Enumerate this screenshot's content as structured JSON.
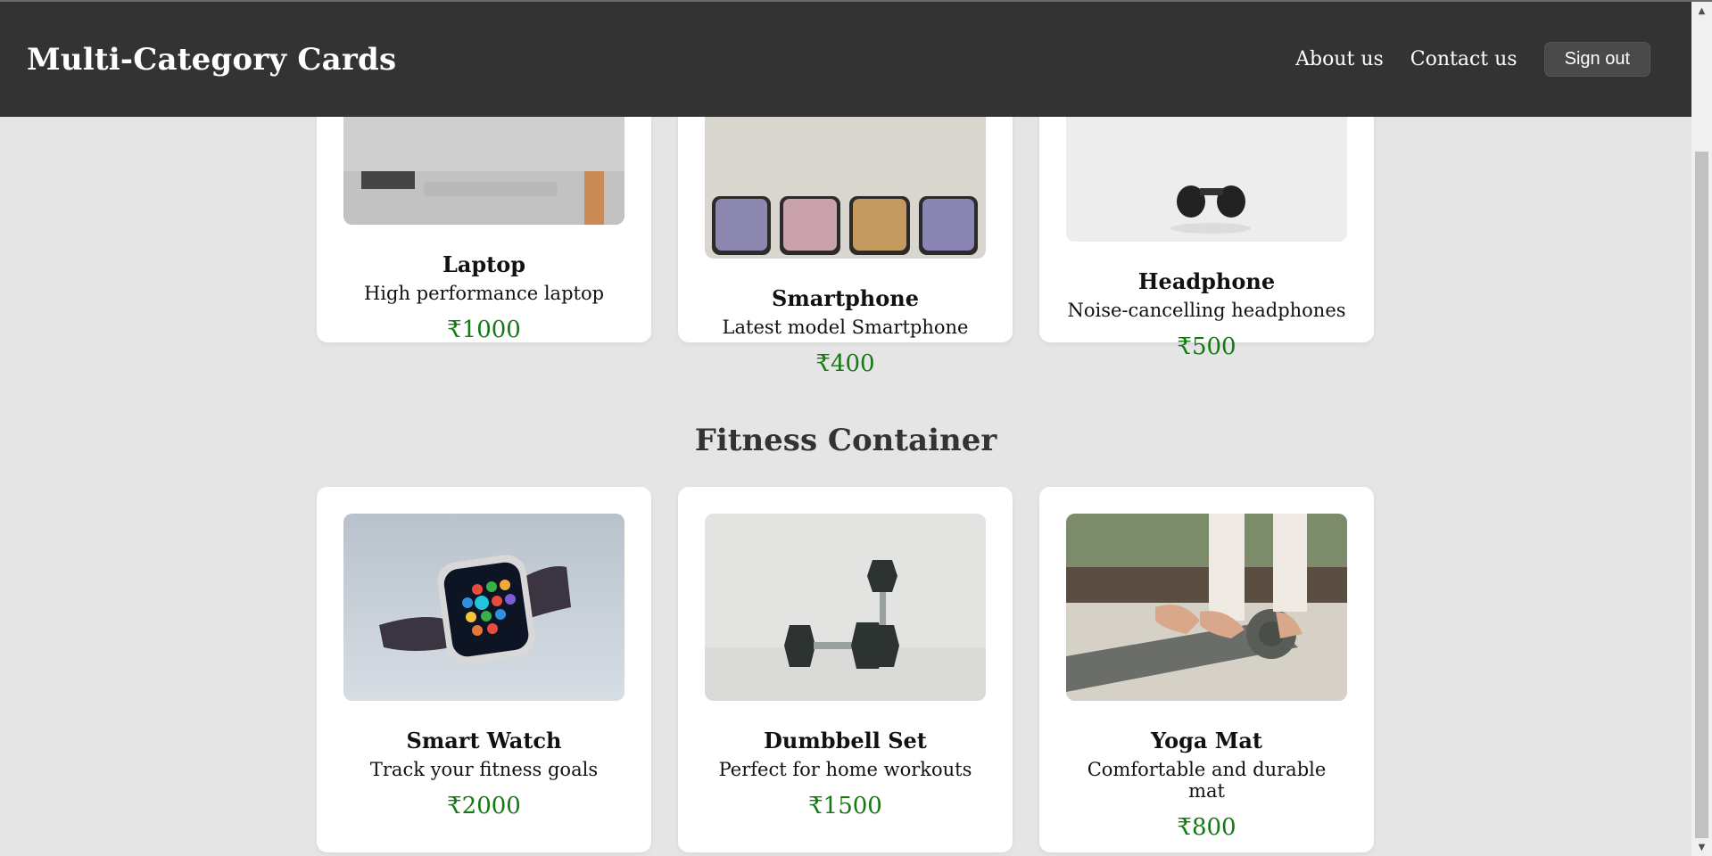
{
  "header": {
    "brand": "Multi-Category Cards",
    "nav": [
      {
        "label": "About us"
      },
      {
        "label": "Contact us"
      }
    ],
    "signout_label": "Sign out"
  },
  "electronics": {
    "cards": [
      {
        "title": "Laptop",
        "desc": "High performance laptop",
        "price": "₹1000"
      },
      {
        "title": "Smartphone",
        "desc": "Latest model Smartphone",
        "price": "₹400"
      },
      {
        "title": "Headphone",
        "desc": "Noise-cancelling headphones",
        "price": "₹500"
      }
    ]
  },
  "fitness": {
    "title": "Fitness Container",
    "cards": [
      {
        "title": "Smart Watch",
        "desc": "Track your fitness goals",
        "price": "₹2000"
      },
      {
        "title": "Dumbbell Set",
        "desc": "Perfect for home workouts",
        "price": "₹1500"
      },
      {
        "title": "Yoga Mat",
        "desc": "Comfortable and durable mat",
        "price": "₹800"
      }
    ]
  },
  "colors": {
    "header_bg": "#333333",
    "page_bg": "#e5e5e5",
    "price": "#137a13"
  }
}
